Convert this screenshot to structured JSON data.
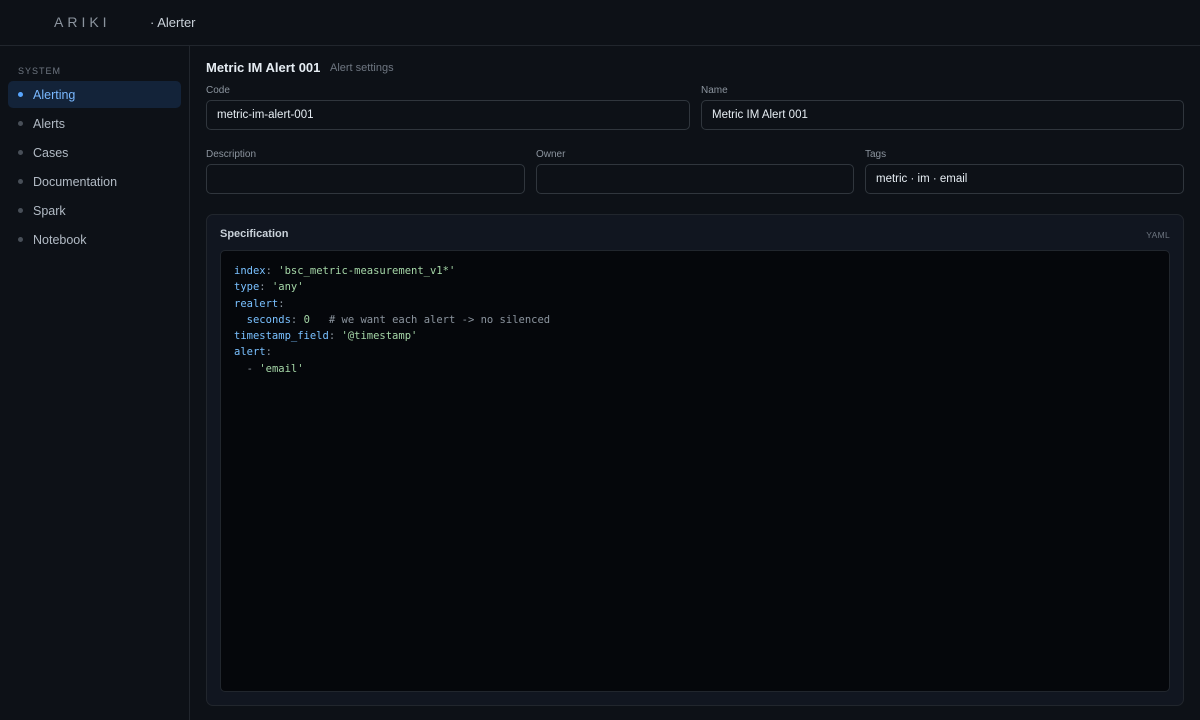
{
  "header": {
    "logo_text": "ARIKI",
    "app_name": "· Alerter"
  },
  "sidebar": {
    "section_label": "SYSTEM",
    "items": [
      {
        "label": "Alerting",
        "active": true
      },
      {
        "label": "Alerts"
      },
      {
        "label": "Cases"
      },
      {
        "label": "Documentation"
      },
      {
        "label": "Spark"
      },
      {
        "label": "Notebook"
      }
    ]
  },
  "page": {
    "title": "Metric IM Alert 001",
    "subtitle": "Alert settings"
  },
  "form": {
    "code": {
      "label": "Code",
      "value": "metric-im-alert-001"
    },
    "name": {
      "label": "Name",
      "value": "Metric IM Alert 001"
    },
    "description": {
      "label": "Description",
      "value": ""
    },
    "owner": {
      "label": "Owner",
      "value": ""
    },
    "tags": {
      "label": "Tags",
      "value": "metric · im · email"
    }
  },
  "spec": {
    "title": "Specification",
    "format": "YAML",
    "lines": [
      {
        "key": "index",
        "sep": ": ",
        "val": "'bsc_metric-measurement_v1*'",
        "cls": "s"
      },
      {
        "key": "type",
        "sep": ": ",
        "val": "'any'",
        "cls": "s"
      },
      {
        "key": "realert",
        "sep": ":",
        "val": "",
        "cls": "s"
      },
      {
        "indent": "  ",
        "key": "seconds",
        "sep": ": ",
        "val": "0",
        "cls": "n",
        "comment": "   # we want each alert -> no silenced"
      },
      {
        "key": "timestamp_field",
        "sep": ": ",
        "val": "'@timestamp'",
        "cls": "s"
      },
      {
        "key": "alert",
        "sep": ":",
        "val": "",
        "cls": "s"
      },
      {
        "indent": "  ",
        "dash": "- ",
        "val": "'email'",
        "cls": "s"
      }
    ]
  },
  "colors": {
    "accent": "#58a6ff",
    "background": "#0d1117",
    "editor_bg": "#05070b",
    "yaml_key": "#79c0ff",
    "yaml_string": "#a5d6a7"
  }
}
